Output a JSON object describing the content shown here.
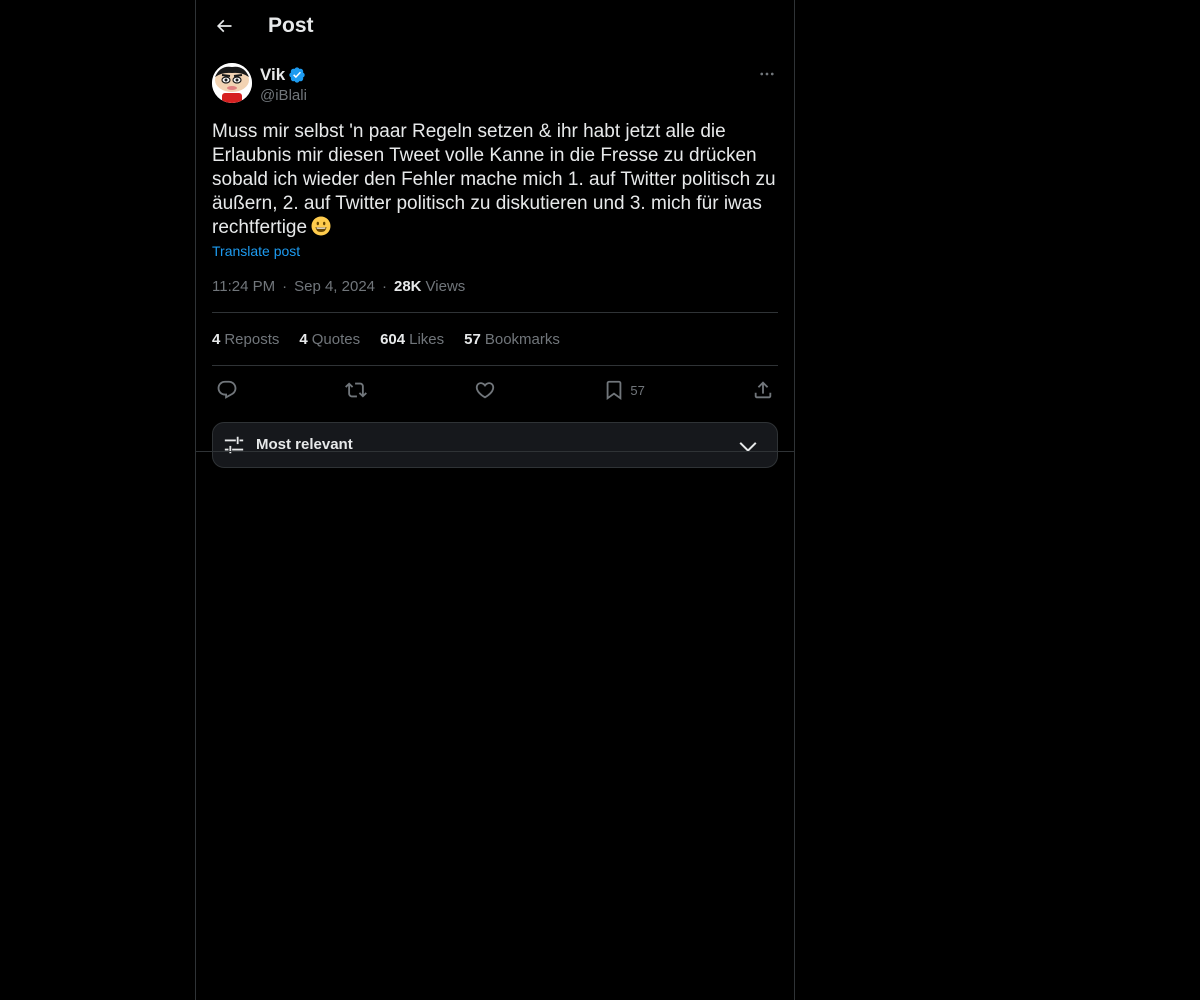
{
  "header": {
    "title": "Post",
    "back_icon": "arrow-left-icon"
  },
  "post": {
    "author": {
      "name": "Vik",
      "handle": "@iBlali",
      "verified": true,
      "avatar_icon": "cartoon-avatar"
    },
    "text": "Muss mir selbst 'n paar Regeln setzen & ihr habt jetzt alle die Erlaubnis mir diesen Tweet volle Kanne in die Fresse zu drücken sobald ich wieder den Fehler mache mich 1. auf Twitter politisch zu äußern, 2. auf Twitter politisch zu diskutieren und 3. mich für iwas rechtfertige",
    "emoji": "grinning-face-emoji",
    "translate_label": "Translate post",
    "time": "11:24 PM",
    "date": "Sep 4, 2024",
    "separator": "·",
    "views_count": "28K",
    "views_label": "Views"
  },
  "stats": {
    "reposts": {
      "count": "4",
      "label": "Reposts"
    },
    "quotes": {
      "count": "4",
      "label": "Quotes"
    },
    "likes": {
      "count": "604",
      "label": "Likes"
    },
    "bookmarks": {
      "count": "57",
      "label": "Bookmarks"
    }
  },
  "actions": {
    "reply_icon": "reply-icon",
    "repost_icon": "repost-icon",
    "like_icon": "heart-icon",
    "bookmark_icon": "bookmark-icon",
    "bookmark_count": "57",
    "share_icon": "share-icon"
  },
  "sort": {
    "label": "Most relevant",
    "icon": "sliders-icon",
    "chevron": "chevron-down-icon"
  },
  "colors": {
    "background": "#000000",
    "text": "#e7e9ea",
    "muted": "#71767b",
    "accent": "#1d9bf0",
    "border": "#2f3336",
    "verified": "#1d9bf0"
  }
}
